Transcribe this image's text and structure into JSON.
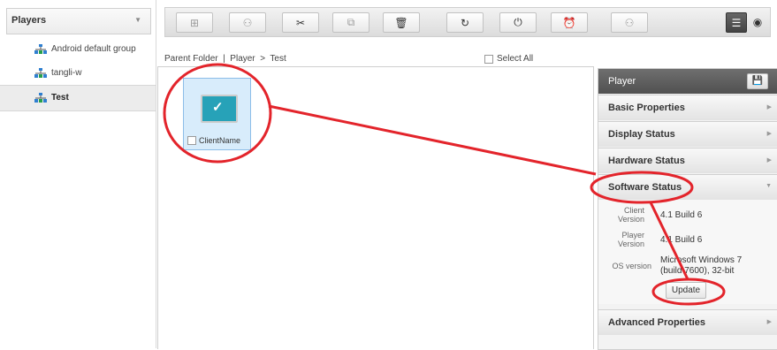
{
  "sidebar": {
    "title": "Players",
    "groups": [
      {
        "label": "Android default group"
      },
      {
        "label": "tangli-w"
      },
      {
        "label": "Test"
      }
    ]
  },
  "toolbar": {
    "icons": [
      "add-folder-icon",
      "add-group-icon",
      "cut-icon",
      "copy-icon",
      "delete-icon",
      "refresh-icon",
      "power-icon",
      "restart-icon",
      "group-settings-icon",
      "list-view-icon",
      "settings-icon"
    ]
  },
  "breadcrumb": {
    "text": "Parent Folder  |  Player  >  Test"
  },
  "select_all": "Select All",
  "tile": {
    "label": "ClientName"
  },
  "panel": {
    "title": "Player",
    "sections": {
      "basic": "Basic Properties",
      "display": "Display Status",
      "hardware": "Hardware Status",
      "software": "Software Status",
      "advanced": "Advanced Properties"
    },
    "software_status": {
      "client_version_label": "Client Version",
      "client_version_value": "4.1 Build 6",
      "player_version_label": "Player Version",
      "player_version_value": "4.1 Build 6",
      "os_version_label": "OS version",
      "os_version_value": "Microsoft Windows 7 (build 7600), 32-bit",
      "update_button": "Update"
    }
  },
  "colors": {
    "annotation": "#e3242b",
    "tile_bg": "#d8ecfb",
    "screen": "#27a2b8",
    "panel_header": "#5a5a5a"
  }
}
